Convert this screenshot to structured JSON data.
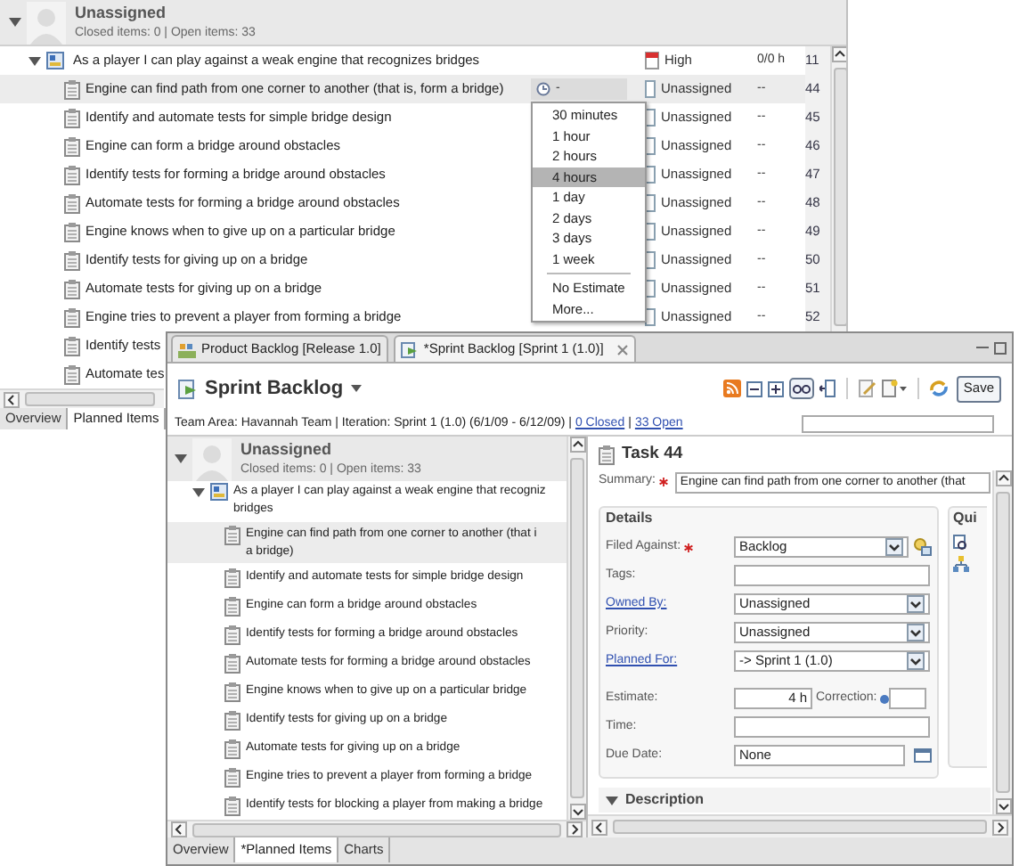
{
  "background_window": {
    "group": {
      "name": "Unassigned",
      "summary": "Closed items: 0 | Open items: 33",
      "expanded": true
    },
    "story": {
      "title": "As a player I can play against a weak engine that recognizes bridges",
      "expanded": true,
      "priority": "High",
      "time": "0/0 h",
      "id": "11"
    },
    "tasks": [
      {
        "title": "Engine can find path from one corner to another (that is, form a bridge)",
        "selected": true,
        "estimate": "-",
        "status": "Unassigned",
        "time": "--",
        "id": "44"
      },
      {
        "title": "Identify and automate tests for simple bridge design",
        "selected": false,
        "status": "Unassigned",
        "time": "--",
        "id": "45"
      },
      {
        "title": "Engine can form a bridge around obstacles",
        "selected": false,
        "status": "Unassigned",
        "time": "--",
        "id": "46"
      },
      {
        "title": "Identify tests for forming a bridge around obstacles",
        "selected": false,
        "status": "Unassigned",
        "time": "--",
        "id": "47"
      },
      {
        "title": "Automate tests for forming a bridge around obstacles",
        "selected": false,
        "status": "Unassigned",
        "time": "--",
        "id": "48"
      },
      {
        "title": "Engine knows when to give up on a particular bridge",
        "selected": false,
        "status": "Unassigned",
        "time": "--",
        "id": "49"
      },
      {
        "title": "Identify tests for giving up on a bridge",
        "selected": false,
        "status": "Unassigned",
        "time": "--",
        "id": "50"
      },
      {
        "title": "Automate tests for giving up on a bridge",
        "selected": false,
        "status": "Unassigned",
        "time": "--",
        "id": "51"
      },
      {
        "title": "Engine tries to prevent a player from forming a bridge",
        "selected": false,
        "status": "Unassigned",
        "time": "--",
        "id": "52"
      },
      {
        "title": "Identify tests",
        "selected": false
      },
      {
        "title": "Automate tes",
        "selected": false
      }
    ],
    "estimate_menu": {
      "durations": [
        {
          "label": "30 minutes",
          "selected": false
        },
        {
          "label": "1 hour",
          "selected": false
        },
        {
          "label": "2 hours",
          "selected": false
        },
        {
          "label": "4 hours",
          "selected": true
        },
        {
          "label": "1 day",
          "selected": false
        },
        {
          "label": "2 days",
          "selected": false
        },
        {
          "label": "3 days",
          "selected": false
        },
        {
          "label": "1 week",
          "selected": false
        }
      ],
      "other": [
        {
          "label": "No Estimate",
          "selected": false
        },
        {
          "label": "More...",
          "selected": false
        }
      ]
    },
    "tabs": [
      {
        "label": "Overview",
        "selected": false
      },
      {
        "label": "Planned Items",
        "selected": true
      }
    ]
  },
  "editor": {
    "tabs": [
      {
        "label": "Product Backlog [Release 1.0]",
        "selected": false
      },
      {
        "label": "*Sprint Backlog [Sprint 1 (1.0)]",
        "selected": true
      }
    ],
    "title": "Sprint Backlog",
    "save_label": "Save",
    "info": {
      "text": "Team Area: Havannah Team | Iteration: Sprint 1 (1.0) (6/1/09 - 6/12/09) |",
      "links": [
        "0 Closed",
        "33 Open"
      ],
      "separator": "|"
    },
    "plan": {
      "group": {
        "name": "Unassigned",
        "summary": "Closed items: 0 | Open items: 33",
        "expanded": true
      },
      "story": {
        "lines": [
          "As a player I can play against a weak engine that recogniz",
          "bridges"
        ],
        "expanded": true
      },
      "tasks": [
        {
          "lines": [
            "Engine can find path from one corner to another (that i",
            "a bridge)"
          ],
          "selected": true
        },
        {
          "lines": [
            "Identify and automate tests for simple bridge design"
          ],
          "selected": false
        },
        {
          "lines": [
            "Engine can form a bridge around obstacles"
          ],
          "selected": false
        },
        {
          "lines": [
            "Identify tests for forming a bridge around obstacles"
          ],
          "selected": false
        },
        {
          "lines": [
            "Automate tests for forming a bridge around obstacles"
          ],
          "selected": false
        },
        {
          "lines": [
            "Engine knows when to give up on a particular bridge"
          ],
          "selected": false
        },
        {
          "lines": [
            "Identify tests for giving up on a bridge"
          ],
          "selected": false
        },
        {
          "lines": [
            "Automate tests for giving up on a bridge"
          ],
          "selected": false
        },
        {
          "lines": [
            "Engine tries to prevent a player from forming a bridge"
          ],
          "selected": false
        },
        {
          "lines": [
            "Identify tests for blocking a player from making a bridge"
          ],
          "selected": false
        }
      ],
      "tabs": [
        {
          "label": "Overview",
          "selected": false
        },
        {
          "label": "*Planned Items",
          "selected": true
        },
        {
          "label": "Charts",
          "selected": false
        }
      ]
    },
    "task": {
      "title": "Task 44",
      "summary_label": "Summary:",
      "summary_required": true,
      "summary": "Engine can find path from one corner to another (that",
      "details_title": "Details",
      "quick_title": "Qui",
      "description_title": "Description",
      "description_expanded": true,
      "fields": [
        {
          "kind": "combo",
          "label": "Filed Against:",
          "required": true,
          "link": false,
          "value": "Backlog"
        },
        {
          "kind": "text",
          "label": "Tags:",
          "required": false,
          "link": false
        },
        {
          "kind": "combo",
          "label": "Owned By:",
          "required": false,
          "link": true,
          "value": "Unassigned"
        },
        {
          "kind": "combo",
          "label": "Priority:",
          "required": false,
          "link": false,
          "value": "Unassigned"
        },
        {
          "kind": "combo",
          "label": "Planned For:",
          "required": false,
          "link": true,
          "value": "-> Sprint 1 (1.0)"
        },
        {
          "kind": "estimate",
          "label": "Estimate:",
          "required": false,
          "link": false,
          "value": "4 h",
          "correction_label": "Correction:"
        },
        {
          "kind": "text",
          "label": "Time:",
          "required": false,
          "link": false
        },
        {
          "kind": "date",
          "label": "Due Date:",
          "required": false,
          "link": false,
          "value": "None"
        }
      ]
    }
  }
}
